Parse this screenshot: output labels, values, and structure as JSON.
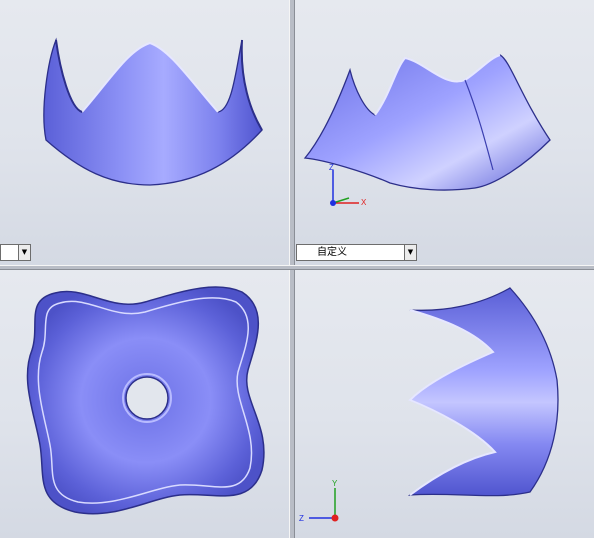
{
  "viewports": {
    "top_left": {
      "combo": {
        "label": "",
        "arrow_icon": "dropdown-arrow-icon"
      }
    },
    "top_right": {
      "combo": {
        "label": "自定义",
        "arrow_icon": "dropdown-arrow-icon"
      },
      "triad": {
        "z": "Z",
        "x": "X"
      }
    },
    "bottom_right": {
      "triad": {
        "y": "Y",
        "z": "Z"
      }
    }
  },
  "colors": {
    "surface": "#7b81ee",
    "surface_light": "#c9ccff",
    "surface_dark": "#3b3fb0",
    "axis_x": "#e02020",
    "axis_y": "#20a020",
    "axis_z": "#2030e0",
    "pane_bg": "#e2e6ed"
  }
}
